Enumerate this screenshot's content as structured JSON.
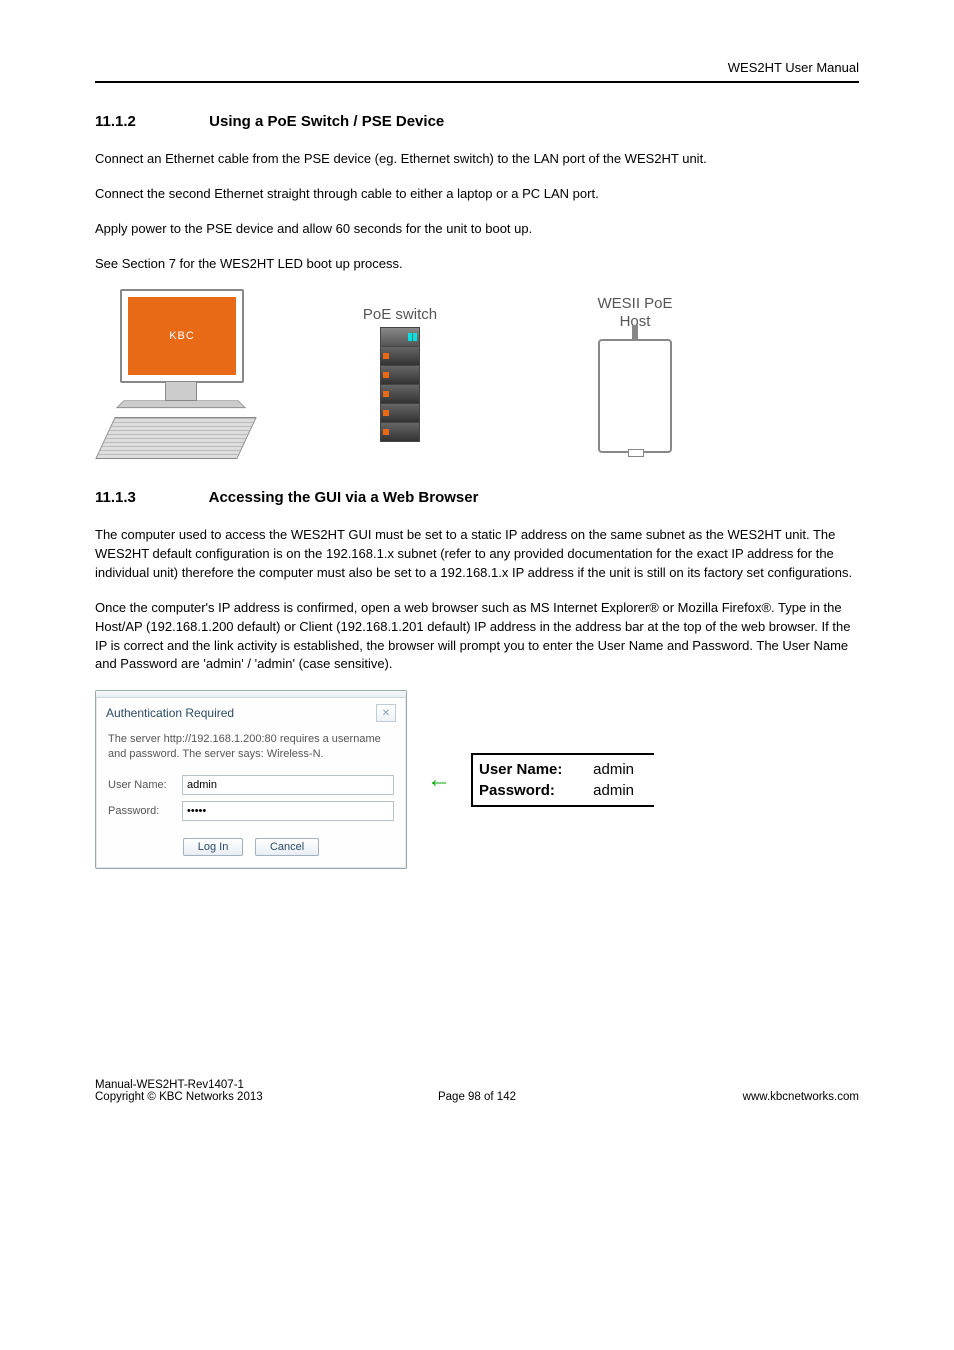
{
  "header": {
    "doc_title": "WES2HT User Manual"
  },
  "section1": {
    "number": "11.1.2",
    "title": "Using a PoE Switch / PSE Device",
    "para1": "Connect an Ethernet cable from the PSE device (eg. Ethernet switch) to the LAN port of the WES2HT unit.",
    "para2": "Connect the second Ethernet straight through cable to either a laptop or a PC LAN port.",
    "para3": "Apply power to the PSE device and allow 60 seconds for the unit to boot up.",
    "para4": "See Section 7 for the WES2HT LED boot up process."
  },
  "figure1": {
    "monitor_brand": "KBC",
    "switch_label": "PoE switch",
    "host_label_line1": "WESII PoE",
    "host_label_line2": "Host"
  },
  "section2": {
    "number": "11.1.3",
    "title": "Accessing the GUI via a Web Browser",
    "para1": "The computer used to access the WES2HT GUI must be set to a static IP address on the same subnet as the WES2HT unit. The WES2HT default configuration is on the 192.168.1.x subnet (refer to any provided documentation for the exact IP address for the individual unit) therefore the computer must also be set to a 192.168.1.x IP address if the unit is still on its factory set configurations.",
    "para2": "Once the computer's IP address is confirmed, open a web browser such as MS Internet Explorer® or Mozilla Firefox®. Type in the Host/AP (192.168.1.200 default) or Client (192.168.1.201 default) IP address in the address bar at the top of the web browser. If the IP is correct and the link activity is established, the browser will prompt you to enter the User Name and Password. The User Name and Password are 'admin' / 'admin' (case sensitive)."
  },
  "dialog": {
    "title": "Authentication Required",
    "close_glyph": "✕",
    "message": "The server http://192.168.1.200:80 requires a username and password. The server says: Wireless-N.",
    "username_label": "User Name:",
    "username_value": "admin",
    "password_label": "Password:",
    "password_value": "•••••",
    "login_btn": "Log In",
    "cancel_btn": "Cancel"
  },
  "arrow_glyph": "←",
  "credentials": {
    "username_label": "User Name:",
    "username_value": "admin",
    "password_label": "Password:",
    "password_value": "admin"
  },
  "footer": {
    "left_line1": "Manual-WES2HT-Rev1407-1",
    "left_line2": "Copyright © KBC Networks 2013",
    "center": "Page 98 of 142",
    "right": "www.kbcnetworks.com"
  }
}
